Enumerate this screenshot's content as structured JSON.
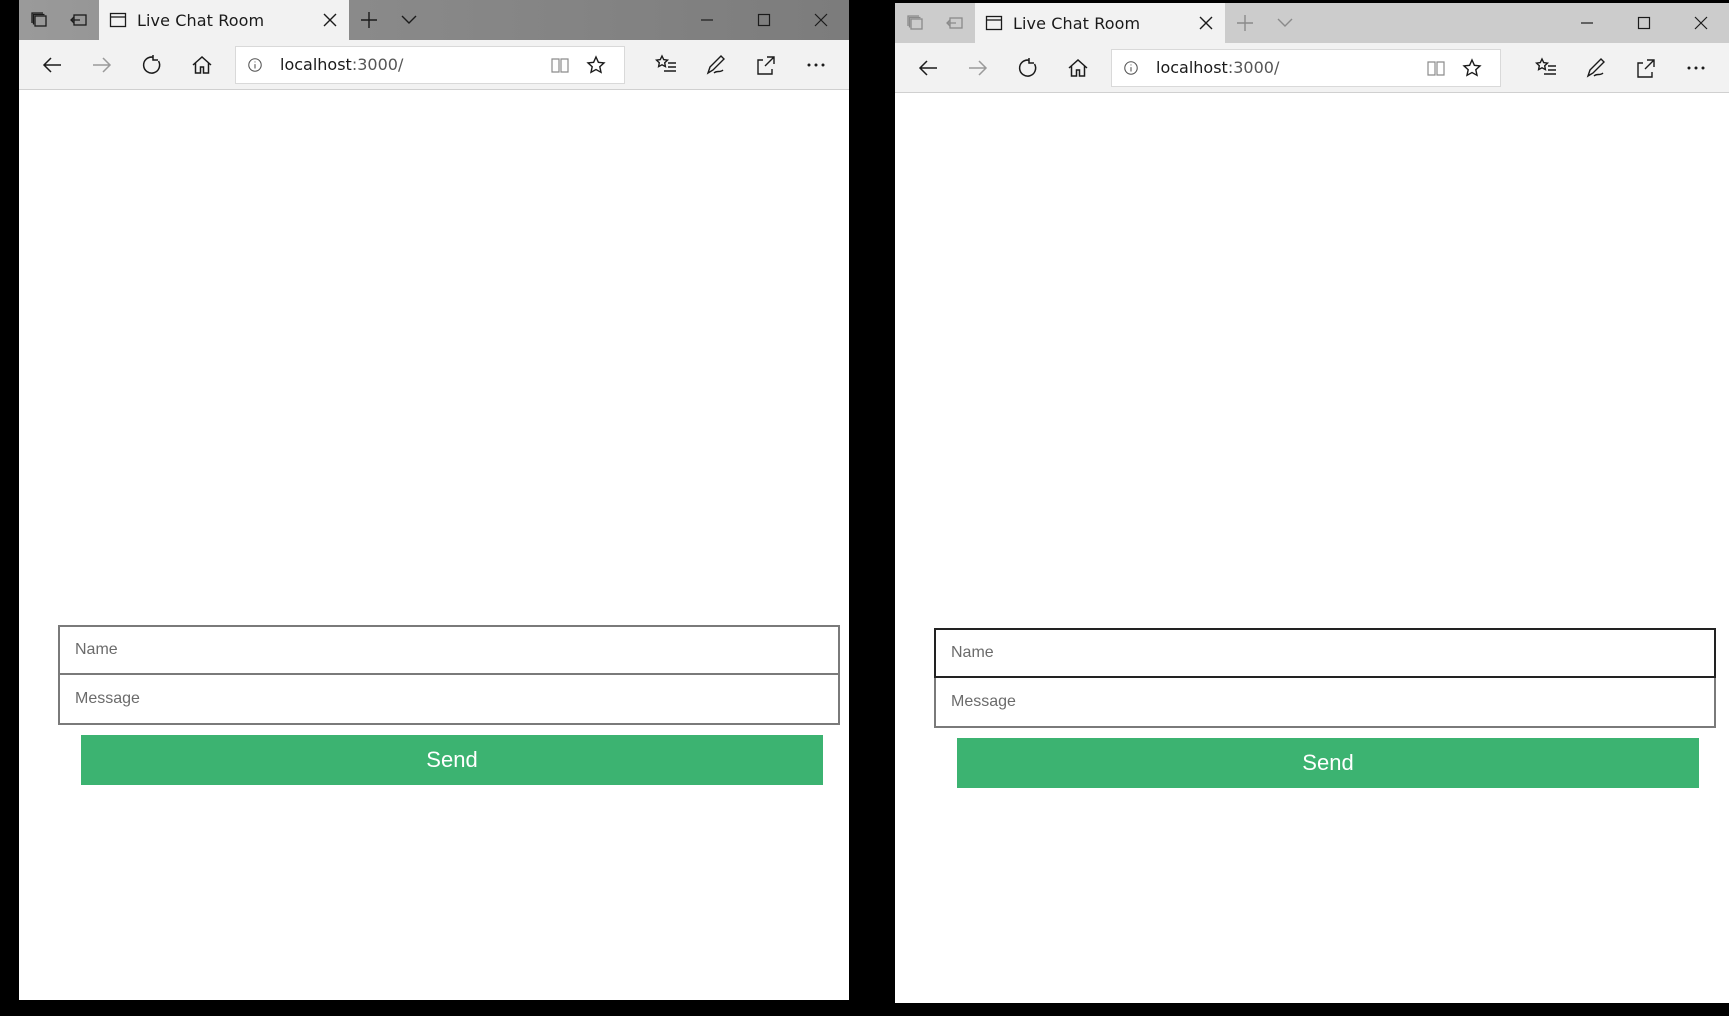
{
  "colors": {
    "send_button": "#3cb371",
    "tab_active": "#f2f2f2",
    "titlebar_left": "#8a8a8a",
    "titlebar_right": "#cccccc"
  },
  "windows": [
    {
      "id": "left",
      "tab": {
        "title": "Live Chat Room"
      },
      "address": {
        "host": "localhost",
        "rest": ":3000/"
      },
      "form": {
        "name_placeholder": "Name",
        "message_placeholder": "Message",
        "send_label": "Send"
      }
    },
    {
      "id": "right",
      "tab": {
        "title": "Live Chat Room"
      },
      "address": {
        "host": "localhost",
        "rest": ":3000/"
      },
      "form": {
        "name_placeholder": "Name",
        "message_placeholder": "Message",
        "send_label": "Send"
      }
    }
  ],
  "icons": {
    "titlebar": [
      "tab-preview-icon",
      "set-aside-tabs-icon",
      "new-tab-icon",
      "tab-list-chevron-icon"
    ],
    "caption": [
      "minimize-icon",
      "maximize-icon",
      "close-icon"
    ],
    "nav": [
      "back-icon",
      "forward-icon",
      "refresh-icon",
      "home-icon"
    ],
    "address": [
      "site-info-icon",
      "reading-view-icon",
      "favorite-star-icon"
    ],
    "toolbar": [
      "favorites-hub-icon",
      "web-note-icon",
      "share-icon",
      "more-icon"
    ]
  }
}
